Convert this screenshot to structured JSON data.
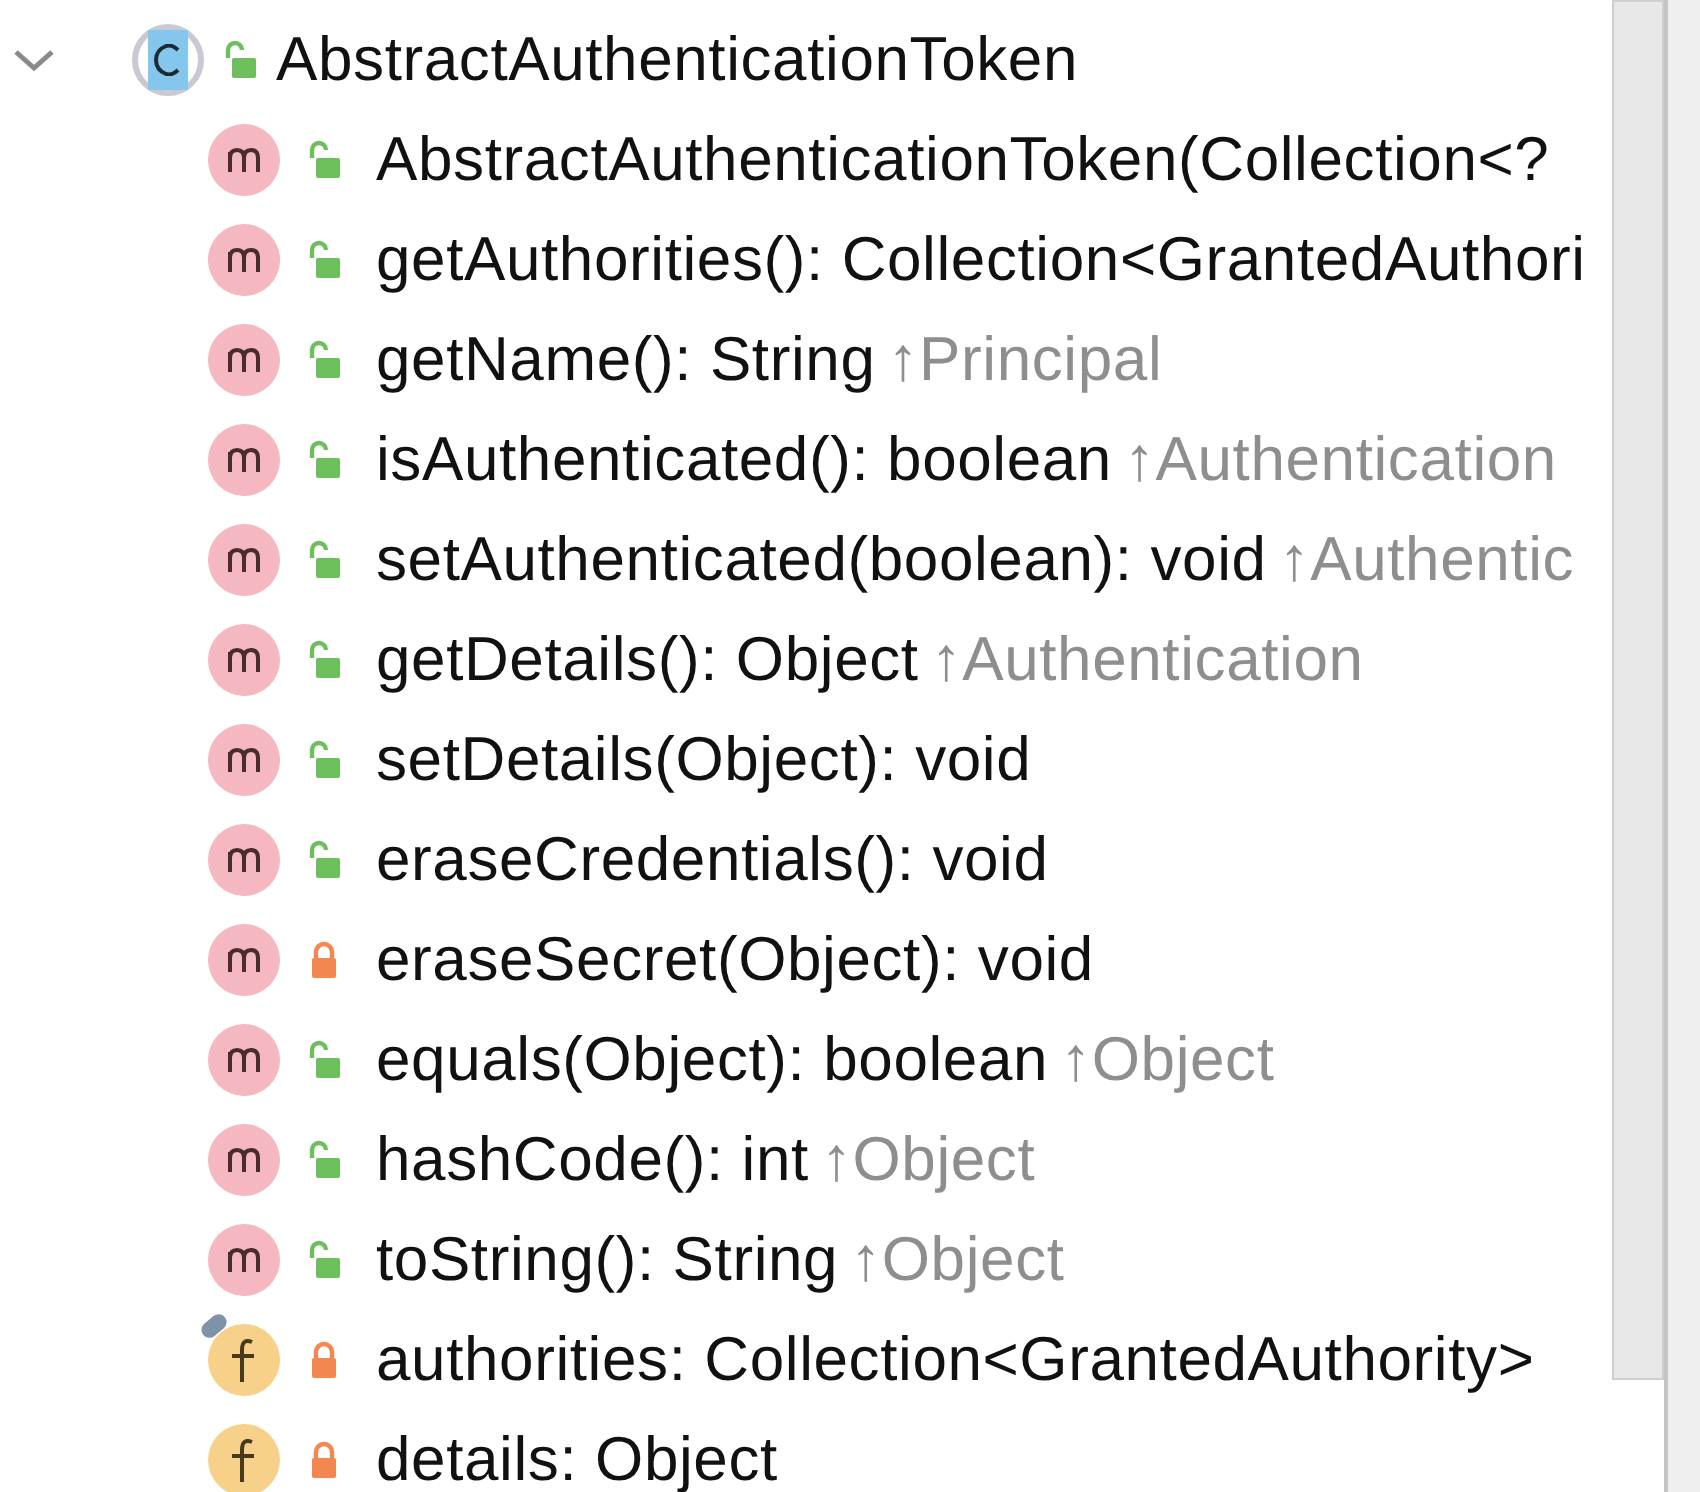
{
  "class_node": {
    "expanded": true,
    "kind": "class",
    "private": false,
    "name": "AbstractAuthenticationToken"
  },
  "members": [
    {
      "kind": "method",
      "private": false,
      "tagged": false,
      "signature": "AbstractAuthenticationToken(Collection<?"
    },
    {
      "kind": "method",
      "private": false,
      "tagged": false,
      "signature": "getAuthorities(): Collection<GrantedAuthori"
    },
    {
      "kind": "method",
      "private": false,
      "tagged": false,
      "signature": "getName(): String",
      "inherited": "↑Principal"
    },
    {
      "kind": "method",
      "private": false,
      "tagged": false,
      "signature": "isAuthenticated(): boolean",
      "inherited": "↑Authentication"
    },
    {
      "kind": "method",
      "private": false,
      "tagged": false,
      "signature": "setAuthenticated(boolean): void",
      "inherited": "↑Authentic"
    },
    {
      "kind": "method",
      "private": false,
      "tagged": false,
      "signature": "getDetails(): Object",
      "inherited": "↑Authentication"
    },
    {
      "kind": "method",
      "private": false,
      "tagged": false,
      "signature": "setDetails(Object): void"
    },
    {
      "kind": "method",
      "private": false,
      "tagged": false,
      "signature": "eraseCredentials(): void"
    },
    {
      "kind": "method",
      "private": true,
      "tagged": false,
      "signature": "eraseSecret(Object): void"
    },
    {
      "kind": "method",
      "private": false,
      "tagged": false,
      "signature": "equals(Object): boolean",
      "inherited": "↑Object"
    },
    {
      "kind": "method",
      "private": false,
      "tagged": false,
      "signature": "hashCode(): int",
      "inherited": "↑Object"
    },
    {
      "kind": "method",
      "private": false,
      "tagged": false,
      "signature": "toString(): String",
      "inherited": "↑Object"
    },
    {
      "kind": "field",
      "private": true,
      "tagged": true,
      "signature": "authorities: Collection<GrantedAuthority>"
    },
    {
      "kind": "field",
      "private": true,
      "tagged": false,
      "signature": "details: Object"
    }
  ]
}
